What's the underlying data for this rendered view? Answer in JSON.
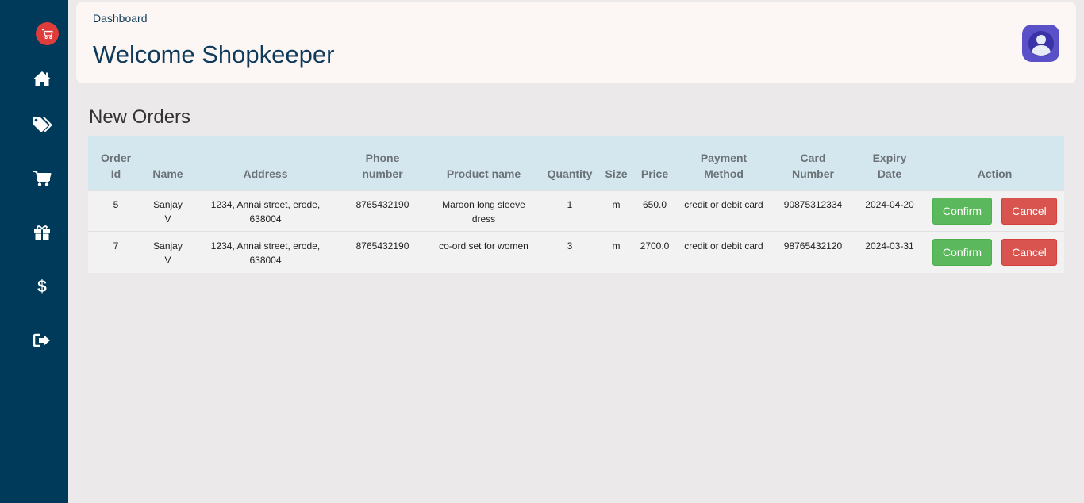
{
  "header": {
    "breadcrumb": "Dashboard",
    "welcome": "Welcome Shopkeeper"
  },
  "sidebar": {
    "items": [
      {
        "icon": "home-icon"
      },
      {
        "icon": "tags-icon"
      },
      {
        "icon": "cart-icon"
      },
      {
        "icon": "gift-icon"
      },
      {
        "icon": "dollar-icon"
      },
      {
        "icon": "logout-icon"
      }
    ]
  },
  "orders": {
    "title": "New Orders",
    "columns": {
      "order_id": [
        "Order",
        "Id"
      ],
      "name": "Name",
      "address": "Address",
      "phone": [
        "Phone",
        "number"
      ],
      "product": "Product name",
      "quantity": "Quantity",
      "size": "Size",
      "price": "Price",
      "payment": [
        "Payment",
        "Method"
      ],
      "card": [
        "Card",
        "Number"
      ],
      "expiry": [
        "Expiry",
        "Date"
      ],
      "action": "Action"
    },
    "rows": [
      {
        "order_id": "5",
        "name_first": "Sanjay",
        "name_last": "V",
        "address_line1": "1234, Annai street, erode,",
        "address_line2": "638004",
        "phone": "8765432190",
        "product_line1": "Maroon long sleeve",
        "product_line2": "dress",
        "quantity": "1",
        "size": "m",
        "price": "650.0",
        "payment": "credit or debit card",
        "card": "90875312334",
        "expiry": "2024-04-20",
        "confirm": "Confirm",
        "cancel": "Cancel"
      },
      {
        "order_id": "7",
        "name_first": "Sanjay",
        "name_last": "V",
        "address_line1": "1234, Annai street, erode,",
        "address_line2": "638004",
        "phone": "8765432190",
        "product_line1": "co-ord set for women",
        "product_line2": "",
        "quantity": "3",
        "size": "m",
        "price": "2700.0",
        "payment": "credit or debit card",
        "card": "98765432120",
        "expiry": "2024-03-31",
        "confirm": "Confirm",
        "cancel": "Cancel"
      }
    ]
  },
  "colors": {
    "sidebar": "#003a5a",
    "accent_text": "#0f3a5a",
    "confirm": "#5cb85c",
    "cancel": "#d9534f",
    "logo": "#e03c3c"
  }
}
